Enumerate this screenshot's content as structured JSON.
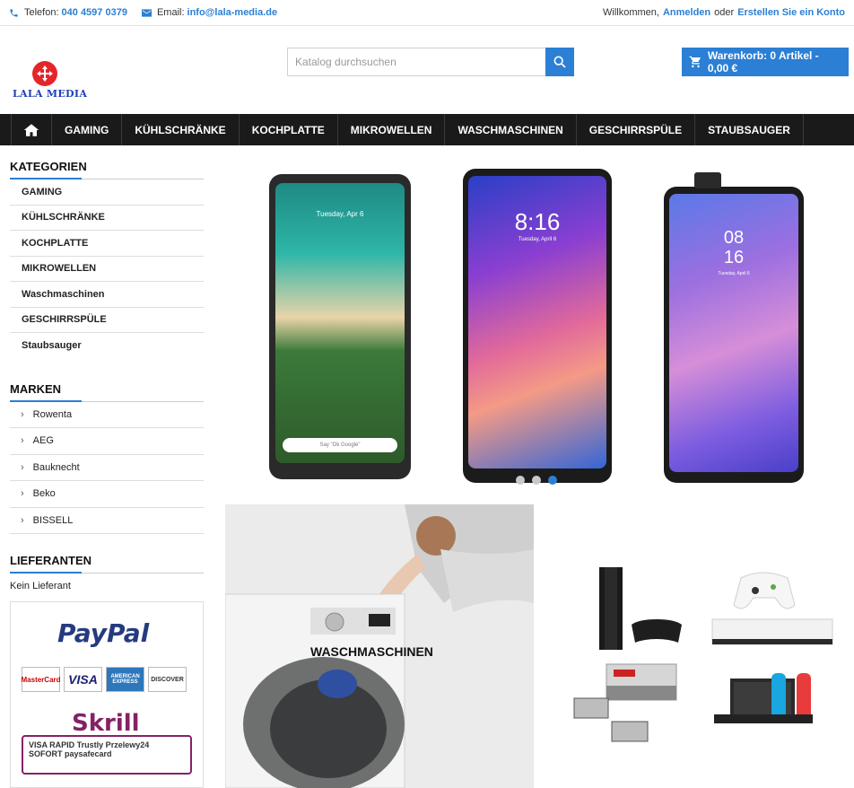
{
  "topbar": {
    "phone_label": "Telefon:",
    "phone_value": "040 4597 0379",
    "email_label": "Email:",
    "email_value": "info@lala-media.de",
    "welcome": "Willkommen,",
    "login": "Anmelden",
    "or": "oder",
    "register": "Erstellen Sie ein Konto"
  },
  "logo": {
    "text": "LALA MEDIA"
  },
  "search": {
    "placeholder": "Katalog durchsuchen",
    "icon": "search-icon"
  },
  "cart": {
    "label": "Warenkorb: 0 Artikel - 0,00 €",
    "icon": "cart-icon"
  },
  "nav": {
    "home_icon": "home-icon",
    "items": [
      "GAMING",
      "KÜHLSCHRÄNKE",
      "KOCHPLATTE",
      "MIKROWELLEN",
      "WASCHMASCHINEN",
      "GESCHIRRSPÜLE",
      "STAUBSAUGER"
    ]
  },
  "sidebar": {
    "categories_title": "KATEGORIEN",
    "categories": [
      "GAMING",
      "KÜHLSCHRÄNKE",
      "KOCHPLATTE",
      "MIKROWELLEN",
      "Waschmaschinen",
      "GESCHIRRSPÜLE",
      "Staubsauger"
    ],
    "brands_title": "MARKEN",
    "brands": [
      "Rowenta",
      "AEG",
      "Bauknecht",
      "Beko",
      "BISSELL"
    ],
    "suppliers_title": "LIEFERANTEN",
    "supplier_text": "Kein Lieferant"
  },
  "payments": {
    "paypal": "PayPal",
    "cards": [
      "MasterCard",
      "VISA",
      "AMERICAN EXPRESS",
      "DISCOVER"
    ],
    "skrill": "Skrill",
    "skrill_methods": "VISA  RAPID  Trustly  Przelewy24  SOFORT  paysafecard"
  },
  "slider": {
    "screen1_date": "Tuesday, Apr 6",
    "screen2_time": "8:16",
    "screen2_date": "Tuesday, April 6",
    "screen3_hour": "08",
    "screen3_min": "16",
    "screen3_date": "Tuesday, April 6",
    "search_bar": "Say \"Ok Google\""
  },
  "banners": {
    "wash_label": "WASCHMASCHINEN"
  },
  "colors": {
    "accent": "#2b7fd4",
    "nav_bg": "#1a1a1a",
    "logo_red": "#e4262b",
    "logo_blue": "#1f3fb6"
  }
}
